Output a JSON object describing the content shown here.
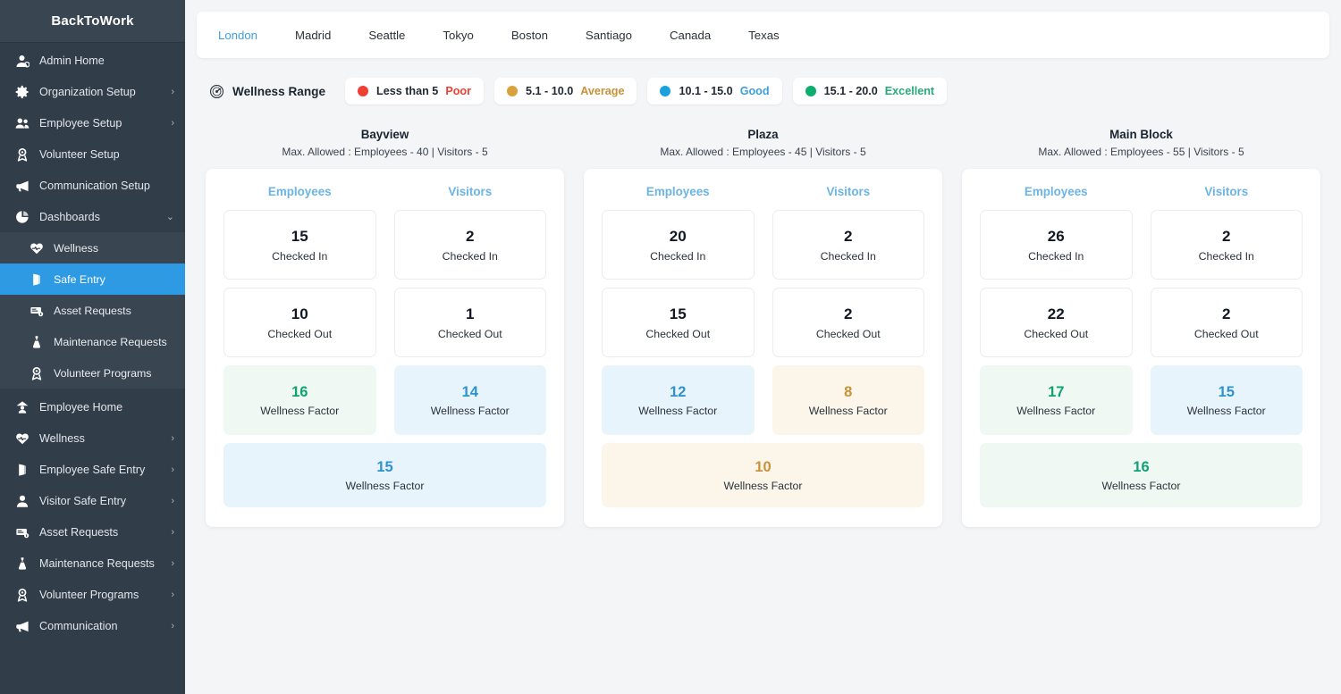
{
  "sidebar": {
    "brand": "BackToWork",
    "items": [
      {
        "label": "Admin Home",
        "icon": "admin-user-icon",
        "chevron": "",
        "level": "top",
        "active": false
      },
      {
        "label": "Organization Setup",
        "icon": "gear-icon",
        "chevron": "›",
        "level": "top",
        "active": false
      },
      {
        "label": "Employee Setup",
        "icon": "people-icon",
        "chevron": "›",
        "level": "top",
        "active": false
      },
      {
        "label": "Volunteer Setup",
        "icon": "badge-person-icon",
        "chevron": "",
        "level": "top",
        "active": false
      },
      {
        "label": "Communication Setup",
        "icon": "megaphone-icon",
        "chevron": "",
        "level": "top",
        "active": false
      },
      {
        "label": "Dashboards",
        "icon": "pie-chart-icon",
        "chevron": "⌄",
        "level": "top",
        "active": false
      },
      {
        "label": "Wellness",
        "icon": "heart-pulse-icon",
        "chevron": "",
        "level": "sub",
        "active": false
      },
      {
        "label": "Safe Entry",
        "icon": "door-icon",
        "chevron": "",
        "level": "sub",
        "active": true
      },
      {
        "label": "Asset Requests",
        "icon": "asset-tag-icon",
        "chevron": "",
        "level": "sub",
        "active": false
      },
      {
        "label": "Maintenance Requests",
        "icon": "wrench-icon",
        "chevron": "",
        "level": "sub",
        "active": false
      },
      {
        "label": "Volunteer Programs",
        "icon": "badge-person-icon",
        "chevron": "",
        "level": "sub",
        "active": false
      },
      {
        "label": "Employee Home",
        "icon": "home-person-icon",
        "chevron": "",
        "level": "top",
        "active": false
      },
      {
        "label": "Wellness",
        "icon": "heart-pulse-icon",
        "chevron": "›",
        "level": "top",
        "active": false
      },
      {
        "label": "Employee Safe Entry",
        "icon": "door-icon",
        "chevron": "›",
        "level": "top",
        "active": false
      },
      {
        "label": "Visitor Safe Entry",
        "icon": "person-icon",
        "chevron": "›",
        "level": "top",
        "active": false
      },
      {
        "label": "Asset Requests",
        "icon": "asset-tag-icon",
        "chevron": "›",
        "level": "top",
        "active": false
      },
      {
        "label": "Maintenance Requests",
        "icon": "wrench-icon",
        "chevron": "›",
        "level": "top",
        "active": false
      },
      {
        "label": "Volunteer Programs",
        "icon": "badge-person-icon",
        "chevron": "›",
        "level": "top",
        "active": false
      },
      {
        "label": "Communication",
        "icon": "megaphone-icon",
        "chevron": "›",
        "level": "top",
        "active": false
      }
    ]
  },
  "tabs": [
    {
      "label": "London",
      "active": true
    },
    {
      "label": "Madrid",
      "active": false
    },
    {
      "label": "Seattle",
      "active": false
    },
    {
      "label": "Tokyo",
      "active": false
    },
    {
      "label": "Boston",
      "active": false
    },
    {
      "label": "Santiago",
      "active": false
    },
    {
      "label": "Canada",
      "active": false
    },
    {
      "label": "Texas",
      "active": false
    }
  ],
  "legend": {
    "title": "Wellness Range",
    "icon": "gauge-icon",
    "chips": [
      {
        "range": "Less than 5",
        "label": "Poor",
        "dot": "#ef3e33",
        "text": "#ef3e33"
      },
      {
        "range": "5.1 - 10.0",
        "label": "Average",
        "dot": "#d9a13c",
        "text": "#c79239"
      },
      {
        "range": "10.1 - 15.0",
        "label": "Good",
        "dot": "#1ba1dd",
        "text": "#3f9fd8"
      },
      {
        "range": "15.1 - 20.0",
        "label": "Excellent",
        "dot": "#0dad70",
        "text": "#28a97a"
      }
    ]
  },
  "colors": {
    "poor_text": "#ef3e33",
    "average_text": "#c79239",
    "good_text": "#2f92cf",
    "excellent_text": "#12a174",
    "average_bg": "#fbf5ea",
    "good_bg": "#e8f4fb",
    "excellent_bg": "#f0f8f3",
    "accent_blue": "#2f9ae4",
    "sidebar_bg": "#323d4a"
  },
  "columns": {
    "employees": "Employees",
    "visitors": "Visitors"
  },
  "captions": {
    "checked_in": "Checked In",
    "checked_out": "Checked Out",
    "wellness_factor": "Wellness Factor"
  },
  "buildings": [
    {
      "name": "Bayview",
      "meta": "Max. Allowed :  Employees - 40  |  Visitors - 5",
      "max_employees": 40,
      "max_visitors": 5,
      "employees": {
        "checked_in": "15",
        "checked_out": "10",
        "wellness_factor": "16",
        "wf_band": "excellent"
      },
      "visitors": {
        "checked_in": "2",
        "checked_out": "1",
        "wellness_factor": "14",
        "wf_band": "good"
      },
      "overall": {
        "wellness_factor": "15",
        "wf_band": "good"
      }
    },
    {
      "name": "Plaza",
      "meta": "Max. Allowed :  Employees - 45  |  Visitors - 5",
      "max_employees": 45,
      "max_visitors": 5,
      "employees": {
        "checked_in": "20",
        "checked_out": "15",
        "wellness_factor": "12",
        "wf_band": "good"
      },
      "visitors": {
        "checked_in": "2",
        "checked_out": "2",
        "wellness_factor": "8",
        "wf_band": "average"
      },
      "overall": {
        "wellness_factor": "10",
        "wf_band": "average"
      }
    },
    {
      "name": "Main Block",
      "meta": "Max. Allowed :  Employees - 55  |  Visitors - 5",
      "max_employees": 55,
      "max_visitors": 5,
      "employees": {
        "checked_in": "26",
        "checked_out": "22",
        "wellness_factor": "17",
        "wf_band": "excellent"
      },
      "visitors": {
        "checked_in": "2",
        "checked_out": "2",
        "wellness_factor": "15",
        "wf_band": "good"
      },
      "overall": {
        "wellness_factor": "16",
        "wf_band": "excellent"
      }
    }
  ]
}
